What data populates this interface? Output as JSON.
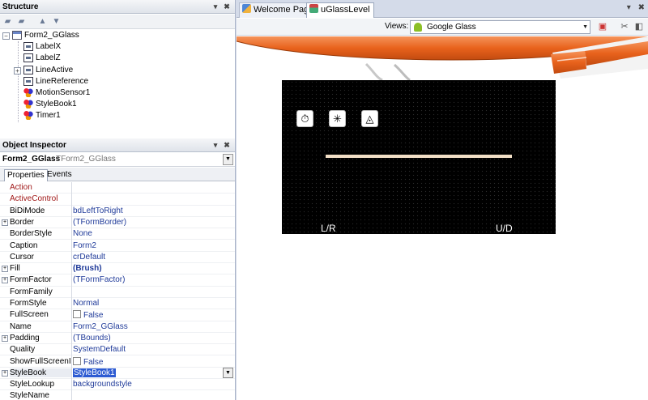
{
  "structure": {
    "title": "Structure",
    "tree": [
      {
        "label": "Form2_GGlass",
        "icon": "form-icon"
      },
      {
        "label": "LabelX",
        "icon": "label-icon"
      },
      {
        "label": "LabelZ",
        "icon": "label-icon"
      },
      {
        "label": "LineActive",
        "icon": "label-icon"
      },
      {
        "label": "LineReference",
        "icon": "label-icon"
      },
      {
        "label": "MotionSensor1",
        "icon": "component-icon"
      },
      {
        "label": "StyleBook1",
        "icon": "component-icon"
      },
      {
        "label": "Timer1",
        "icon": "component-icon"
      }
    ]
  },
  "inspector": {
    "title": "Object Inspector",
    "object_name": "Form2_GGlass",
    "object_class": "TForm2_GGlass",
    "tabs": [
      "Properties",
      "Events"
    ],
    "properties": [
      {
        "name": "Action",
        "value": ""
      },
      {
        "name": "ActiveControl",
        "value": ""
      },
      {
        "name": "BiDiMode",
        "value": "bdLeftToRight"
      },
      {
        "name": "Border",
        "value": "(TFormBorder)"
      },
      {
        "name": "BorderStyle",
        "value": "None"
      },
      {
        "name": "Caption",
        "value": "Form2"
      },
      {
        "name": "Cursor",
        "value": "crDefault"
      },
      {
        "name": "Fill",
        "value": "(Brush)"
      },
      {
        "name": "FormFactor",
        "value": "(TFormFactor)"
      },
      {
        "name": "FormFamily",
        "value": ""
      },
      {
        "name": "FormStyle",
        "value": "Normal"
      },
      {
        "name": "FullScreen",
        "value": "False"
      },
      {
        "name": "Name",
        "value": "Form2_GGlass"
      },
      {
        "name": "Padding",
        "value": "(TBounds)"
      },
      {
        "name": "Quality",
        "value": "SystemDefault"
      },
      {
        "name": "ShowFullScreenIcon",
        "value": "False"
      },
      {
        "name": "StyleBook",
        "value": "StyleBook1"
      },
      {
        "name": "StyleLookup",
        "value": "backgroundstyle"
      },
      {
        "name": "StyleName",
        "value": ""
      }
    ]
  },
  "designer": {
    "tabs": [
      "Welcome Page",
      "uGlassLevel"
    ],
    "views_label": "Views:",
    "views_value": "Google Glass",
    "screen": {
      "label_left": "L/R",
      "label_right": "U/D"
    }
  },
  "colors": {
    "frame_orange": "#e8621c",
    "screen_bg": "#000000",
    "level_line": "#f2dfc6",
    "selection": "#2d5bd2",
    "event_red": "#a01818",
    "value_blue": "#1f3a99"
  }
}
